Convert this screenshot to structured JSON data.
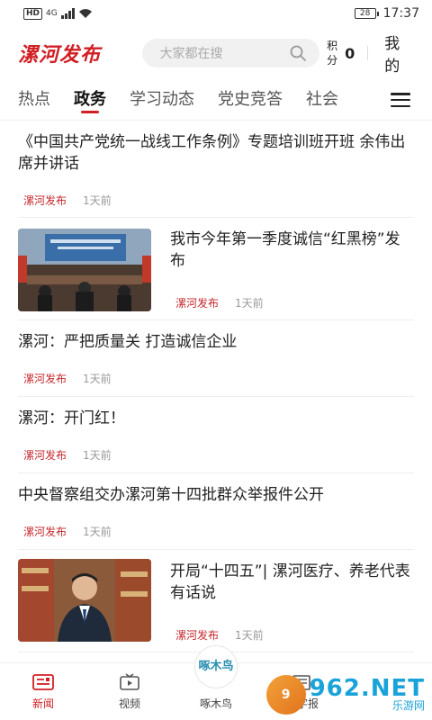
{
  "status_bar": {
    "network": "HD",
    "signal_type": "4G",
    "battery": "28",
    "time": "17:37"
  },
  "header": {
    "logo": "漯河发布",
    "search_placeholder": "大家都在搜",
    "points_label": "积分",
    "points_value": "0",
    "mine": "我的"
  },
  "tabs": [
    {
      "label": "热点",
      "active": false
    },
    {
      "label": "政务",
      "active": true
    },
    {
      "label": "学习动态",
      "active": false
    },
    {
      "label": "党史竞答",
      "active": false
    },
    {
      "label": "社会",
      "active": false
    }
  ],
  "feed": [
    {
      "title": "《中国共产党统一战线工作条例》专题培训班开班 余伟出席并讲话",
      "source": "漯河发布",
      "time": "1天前",
      "thumbnail": false
    },
    {
      "title": "我市今年第一季度诚信“红黑榜”发布",
      "source": "漯河发布",
      "time": "1天前",
      "thumbnail": true
    },
    {
      "title": "漯河：严把质量关 打造诚信企业",
      "source": "漯河发布",
      "time": "1天前",
      "thumbnail": false
    },
    {
      "title": "漯河：开门红！",
      "source": "漯河发布",
      "time": "1天前",
      "thumbnail": false
    },
    {
      "title": "中央督察组交办漯河第十四批群众举报件公开",
      "source": "漯河发布",
      "time": "1天前",
      "thumbnail": false
    },
    {
      "title": "开局“十四五”| 漯河医疗、养老代表有话说",
      "source": "漯河发布",
      "time": "1天前",
      "thumbnail": true
    }
  ],
  "bottom_nav": [
    {
      "label": "新闻",
      "icon": "news-icon",
      "active": true
    },
    {
      "label": "视频",
      "icon": "tv-icon",
      "active": false
    },
    {
      "label": "啄木鸟",
      "icon": "woodpecker-logo",
      "active": false,
      "badge_text": "啄木鸟"
    },
    {
      "label": "数字报",
      "icon": "newspaper-icon",
      "active": false
    }
  ],
  "watermark": {
    "big": "962.NET",
    "small": "乐游网"
  },
  "colors": {
    "brand": "#d11f24",
    "source": "#c4262b",
    "meta": "#999999"
  }
}
